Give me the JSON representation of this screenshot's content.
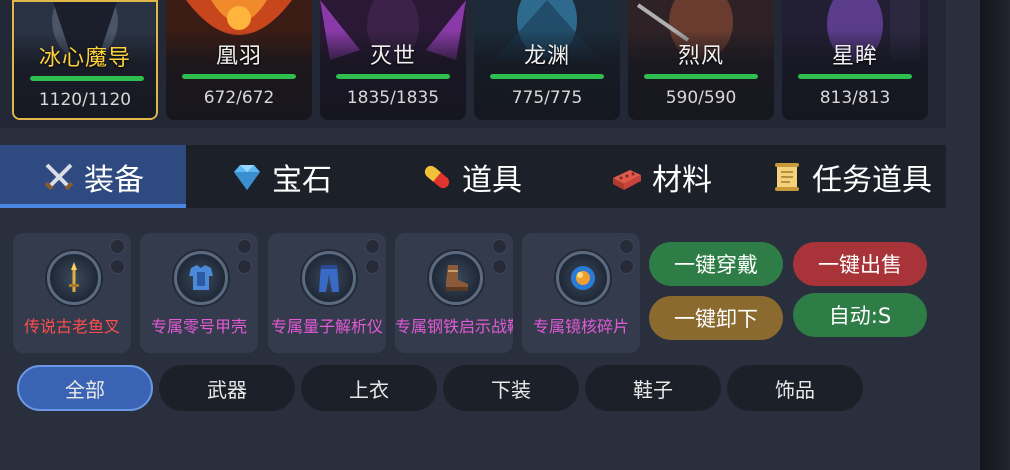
{
  "heroes": [
    {
      "name": "冰心魔导",
      "hp": "1120/1120",
      "hp_fraction": 1.0,
      "selected": true
    },
    {
      "name": "凰羽",
      "hp": "672/672",
      "hp_fraction": 1.0,
      "selected": false
    },
    {
      "name": "灭世",
      "hp": "1835/1835",
      "hp_fraction": 1.0,
      "selected": false
    },
    {
      "name": "龙渊",
      "hp": "775/775",
      "hp_fraction": 1.0,
      "selected": false
    },
    {
      "name": "烈风",
      "hp": "590/590",
      "hp_fraction": 1.0,
      "selected": false
    },
    {
      "name": "星眸",
      "hp": "813/813",
      "hp_fraction": 1.0,
      "selected": false
    }
  ],
  "tabs": [
    {
      "label": "装备",
      "icon": "crossed-swords-icon",
      "active": true
    },
    {
      "label": "宝石",
      "icon": "diamond-icon",
      "active": false
    },
    {
      "label": "道具",
      "icon": "pill-icon",
      "active": false
    },
    {
      "label": "材料",
      "icon": "brick-icon",
      "active": false
    },
    {
      "label": "任务道具",
      "icon": "scroll-icon",
      "active": false
    }
  ],
  "items": [
    {
      "name": "传说古老鱼叉",
      "rarity_color": "#ff4d4d",
      "icon": "trident-icon"
    },
    {
      "name": "专属零号甲壳",
      "rarity_color": "#e25ad6",
      "icon": "armor-icon"
    },
    {
      "name": "专属量子解析仪",
      "rarity_color": "#e25ad6",
      "icon": "pants-icon"
    },
    {
      "name": "专属钢铁启示战靴",
      "rarity_color": "#e25ad6",
      "icon": "boots-icon"
    },
    {
      "name": "专属镜核碎片",
      "rarity_color": "#e25ad6",
      "icon": "orb-icon"
    }
  ],
  "actions": {
    "equip_all": "一键穿戴",
    "sell_all": "一键出售",
    "unequip_all": "一键卸下",
    "auto": "自动:S"
  },
  "filters": [
    {
      "label": "全部",
      "active": true
    },
    {
      "label": "武器",
      "active": false
    },
    {
      "label": "上衣",
      "active": false
    },
    {
      "label": "下装",
      "active": false
    },
    {
      "label": "鞋子",
      "active": false
    },
    {
      "label": "饰品",
      "active": false
    }
  ],
  "colors": {
    "selected_border": "#e0b84a",
    "hp_green": "#2fbf4f",
    "equip_all_bg": "#2e7d46",
    "sell_all_bg": "#a8343a",
    "unequip_all_bg": "#8a6a2e",
    "auto_bg": "#2e7d46",
    "active_tab_bg": "#2e4a80"
  }
}
